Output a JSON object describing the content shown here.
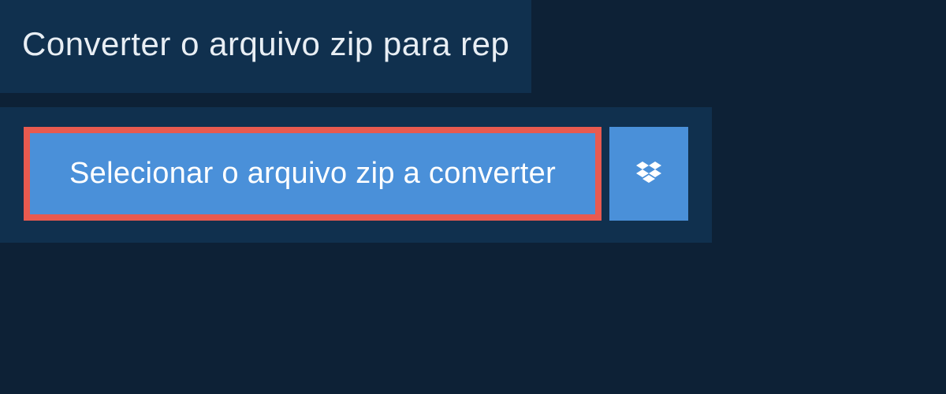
{
  "header": {
    "title": "Converter o arquivo zip para rep"
  },
  "actions": {
    "select_file_label": "Selecionar o arquivo zip a converter"
  }
}
